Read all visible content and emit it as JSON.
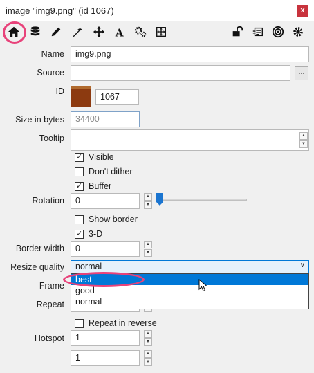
{
  "window": {
    "title": "image \"img9.png\" (id 1067)",
    "close_label": "x"
  },
  "toolbar": {
    "left_icons": [
      "home-icon",
      "database-icon",
      "pencil-icon",
      "magic-wand-icon",
      "move-icon",
      "font-icon",
      "gears-icon",
      "resize-icon"
    ],
    "right_icons": [
      "lock-icon",
      "script-icon",
      "target-icon",
      "settings-icon"
    ]
  },
  "props": {
    "name_label": "Name",
    "name_value": "img9.png",
    "source_label": "Source",
    "source_value": "",
    "browse_label": "...",
    "id_label": "ID",
    "id_value": "1067",
    "size_label": "Size in bytes",
    "size_value": "34400",
    "tooltip_label": "Tooltip",
    "tooltip_value": "",
    "visible_label": "Visible",
    "visible_checked": true,
    "dont_dither_label": "Don't dither",
    "dont_dither_checked": false,
    "buffer_label": "Buffer",
    "buffer_checked": true,
    "rotation_label": "Rotation",
    "rotation_value": "0",
    "show_border_label": "Show border",
    "show_border_checked": false,
    "threed_label": "3-D",
    "threed_checked": true,
    "border_width_label": "Border width",
    "border_width_value": "0",
    "resize_quality_label": "Resize quality",
    "resize_quality_value": "normal",
    "resize_quality_options": [
      "best",
      "good",
      "normal"
    ],
    "frame_label": "Frame",
    "repeat_label": "Repeat",
    "repeat_reverse_label": "Repeat in reverse",
    "repeat_reverse_checked": false,
    "hotspot_label": "Hotspot",
    "hotspot_x": "1",
    "hotspot_y": "1"
  },
  "colors": {
    "accent": "#0078d7",
    "highlight_ring": "#e8427a",
    "close_button": "#c8333d"
  }
}
